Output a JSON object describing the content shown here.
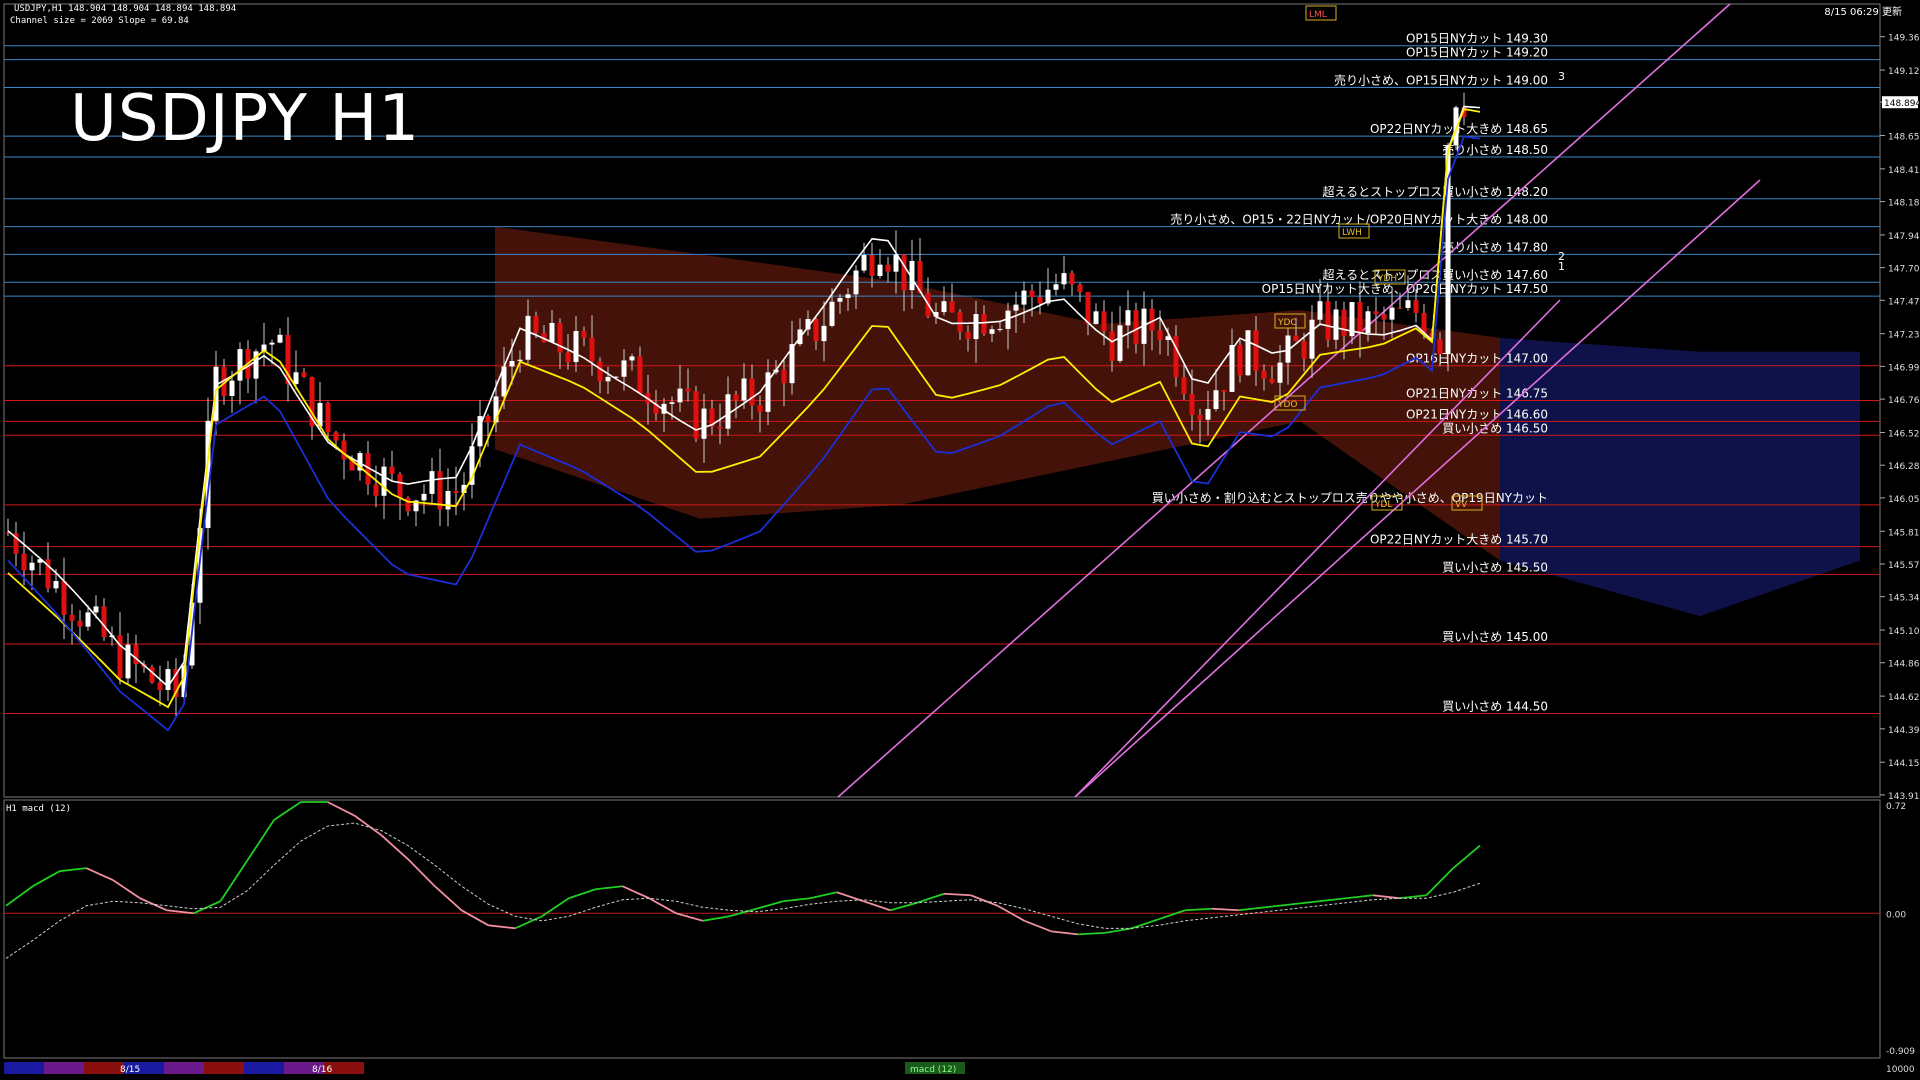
{
  "header": {
    "ohlc_line": "USDJPY,H1  148.904 148.904 148.894 148.894",
    "channel_line": "Channel size = 2069 Slope = 69.84",
    "time": "8/15 06:29 更新"
  },
  "title": "USDJPY H1",
  "subwindow_label": "H1  macd (12)",
  "chart_data": {
    "type": "candlestick",
    "symbol": "USDJPY",
    "timeframe": "H1",
    "current_price": "148.894",
    "price_axis": [
      "149.365",
      "149.125",
      "148.895",
      "148.655",
      "148.415",
      "148.180",
      "147.940",
      "147.705",
      "147.470",
      "147.230",
      "146.995",
      "146.760",
      "146.520",
      "146.285",
      "146.050",
      "145.810",
      "145.575",
      "145.340",
      "145.100",
      "144.865",
      "144.625",
      "144.390",
      "144.150",
      "143.915"
    ],
    "ylim": [
      143.9,
      149.6
    ],
    "levels": [
      {
        "price": 149.3,
        "label": "OP15日NYカット 149.30",
        "color": "#3b86c6"
      },
      {
        "price": 149.2,
        "label": "OP15日NYカット 149.20",
        "color": "#3b86c6"
      },
      {
        "price": 149.0,
        "label": "売り小さめ、OP15日NYカット 149.00",
        "color": "#3b86c6"
      },
      {
        "price": 148.65,
        "label": "OP22日NYカット大きめ 148.65",
        "color": "#3b86c6"
      },
      {
        "price": 148.5,
        "label": "売り小さめ 148.50",
        "color": "#3b86c6"
      },
      {
        "price": 148.2,
        "label": "超えるとストップロス買い小さめ 148.20",
        "color": "#3b86c6"
      },
      {
        "price": 148.0,
        "label": "売り小さめ、OP15・22日NYカット/OP20日NYカット大きめ 148.00",
        "color": "#3b86c6"
      },
      {
        "price": 147.8,
        "label": "売り小さめ 147.80",
        "color": "#3b86c6"
      },
      {
        "price": 147.6,
        "label": "超えるとストップロス買い小さめ 147.60",
        "color": "#3b86c6"
      },
      {
        "price": 147.5,
        "label": "OP15日NYカット大きめ、OP20日NYカット 147.50",
        "color": "#3b86c6"
      },
      {
        "price": 147.0,
        "label": "OP16日NYカット 147.00",
        "color": "#d01818"
      },
      {
        "price": 146.75,
        "label": "OP21日NYカット 146.75",
        "color": "#d01818"
      },
      {
        "price": 146.6,
        "label": "OP21日NYカット 146.60",
        "color": "#d01818"
      },
      {
        "price": 146.5,
        "label": "買い小さめ 146.50",
        "color": "#d01818"
      },
      {
        "price": 146.0,
        "label": "買い小さめ・割り込むとストップロス売りやや小さめ、OP19日NYカット",
        "color": "#d01818"
      },
      {
        "price": 145.7,
        "label": "OP22日NYカット大きめ 145.70",
        "color": "#d01818"
      },
      {
        "price": 145.5,
        "label": "買い小さめ 145.50",
        "color": "#d01818"
      },
      {
        "price": 145.0,
        "label": "買い小さめ 145.00",
        "color": "#d01818"
      },
      {
        "price": 144.5,
        "label": "買い小さめ 144.50",
        "color": "#d01818"
      }
    ],
    "box_labels": [
      "LML",
      "LWH",
      "YDH",
      "YDC",
      "YDO",
      "YDL",
      "VV"
    ],
    "channel_marks": [
      "3",
      "2",
      "1"
    ],
    "macd": {
      "name": "macd (12)",
      "axis": [
        "0.72",
        "0.00",
        "-0.909"
      ],
      "ylim": [
        -0.909,
        0.72
      ],
      "main": [
        0.05,
        0.18,
        0.28,
        0.3,
        0.22,
        0.1,
        0.02,
        0.0,
        0.08,
        0.35,
        0.62,
        0.74,
        0.74,
        0.65,
        0.52,
        0.36,
        0.18,
        0.02,
        -0.08,
        -0.1,
        -0.02,
        0.1,
        0.16,
        0.18,
        0.1,
        0.0,
        -0.05,
        -0.02,
        0.03,
        0.08,
        0.1,
        0.14,
        0.08,
        0.02,
        0.07,
        0.13,
        0.12,
        0.05,
        -0.05,
        -0.12,
        -0.14,
        -0.13,
        -0.1,
        -0.04,
        0.02,
        0.03,
        0.02,
        0.04,
        0.06,
        0.08,
        0.1,
        0.12,
        0.1,
        0.12,
        0.3,
        0.45
      ],
      "signal": [
        -0.3,
        -0.18,
        -0.05,
        0.05,
        0.08,
        0.07,
        0.05,
        0.03,
        0.04,
        0.15,
        0.32,
        0.48,
        0.58,
        0.6,
        0.55,
        0.45,
        0.32,
        0.18,
        0.06,
        -0.02,
        -0.05,
        -0.02,
        0.04,
        0.09,
        0.1,
        0.08,
        0.04,
        0.02,
        0.01,
        0.03,
        0.06,
        0.08,
        0.09,
        0.07,
        0.07,
        0.08,
        0.09,
        0.07,
        0.03,
        -0.02,
        -0.07,
        -0.1,
        -0.1,
        -0.08,
        -0.05,
        -0.03,
        -0.01,
        0.01,
        0.03,
        0.05,
        0.07,
        0.09,
        0.1,
        0.1,
        0.14,
        0.2
      ]
    }
  },
  "date_labels": [
    "8/15",
    "8/16"
  ],
  "scale_note": "macd (12)",
  "bottom_value": "10000"
}
